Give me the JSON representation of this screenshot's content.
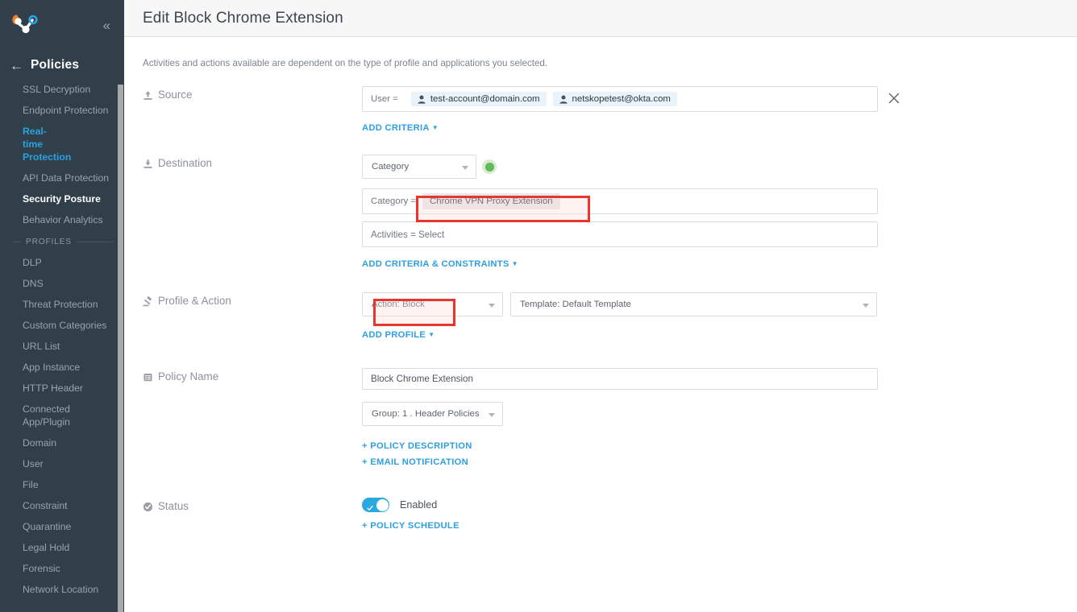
{
  "sidebar": {
    "logo_name": "netskope-logo",
    "collapse_label": "«",
    "back_arrow": "←",
    "nav_title": "Policies",
    "items": [
      {
        "label": "SSL Decryption",
        "state": "normal"
      },
      {
        "label": "Endpoint Protection",
        "state": "normal"
      },
      {
        "label": "Real-time Protection",
        "state": "active"
      },
      {
        "label": "API Data Protection",
        "state": "normal"
      },
      {
        "label": "Security Posture",
        "state": "bold"
      },
      {
        "label": "Behavior Analytics",
        "state": "normal"
      }
    ],
    "section_label": "PROFILES",
    "profile_items": [
      {
        "label": "DLP"
      },
      {
        "label": "DNS"
      },
      {
        "label": "Threat Protection"
      },
      {
        "label": "Custom Categories"
      },
      {
        "label": "URL List"
      },
      {
        "label": "App Instance"
      },
      {
        "label": "HTTP Header"
      },
      {
        "label": "Connected App/Plugin"
      },
      {
        "label": "Domain"
      },
      {
        "label": "User"
      },
      {
        "label": "File"
      },
      {
        "label": "Constraint"
      },
      {
        "label": "Quarantine"
      },
      {
        "label": "Legal Hold"
      },
      {
        "label": "Forensic"
      },
      {
        "label": "Network Location"
      }
    ],
    "colors": {
      "background": "#313f4b",
      "active": "#28a3e1",
      "text": "#97a4ae"
    }
  },
  "header": {
    "title": "Edit Block Chrome Extension"
  },
  "hint": "Activities and actions available are dependent on the type of profile and applications you selected.",
  "source": {
    "label": "Source",
    "icon": "upload-icon",
    "criteria_label": "User =",
    "chips": [
      {
        "label": "test-account@domain.com"
      },
      {
        "label": "netskopetest@okta.com"
      }
    ],
    "remove_label": "×",
    "add_criteria_label": "ADD CRITERIA"
  },
  "destination": {
    "label": "Destination",
    "icon": "download-icon",
    "type_select": "Category",
    "status_dot_color": "#62b95a",
    "category_label": "Category =",
    "category_value": "Chrome VPN Proxy Extension",
    "activities_text": "Activities = Select",
    "add_criteria_label": "ADD CRITERIA & CONSTRAINTS"
  },
  "profile_action": {
    "label": "Profile & Action",
    "icon": "gavel-icon",
    "action_select": "Action: Block",
    "template_select": "Template: Default Template",
    "add_profile_label": "ADD PROFILE"
  },
  "policy_name": {
    "label": "Policy Name",
    "icon": "list-icon",
    "value": "Block Chrome Extension",
    "group_select": "Group: 1 . Header Policies",
    "description_link": "+ POLICY DESCRIPTION",
    "email_link": "+ EMAIL NOTIFICATION"
  },
  "status": {
    "label": "Status",
    "icon": "check-circle-icon",
    "toggle_on": true,
    "toggle_text": "Enabled",
    "schedule_link": "+ POLICY SCHEDULE"
  },
  "annotations": {
    "accent_red": "#e8352e",
    "highlight_category": "category-value-highlight",
    "highlight_action": "action-block-highlight"
  }
}
